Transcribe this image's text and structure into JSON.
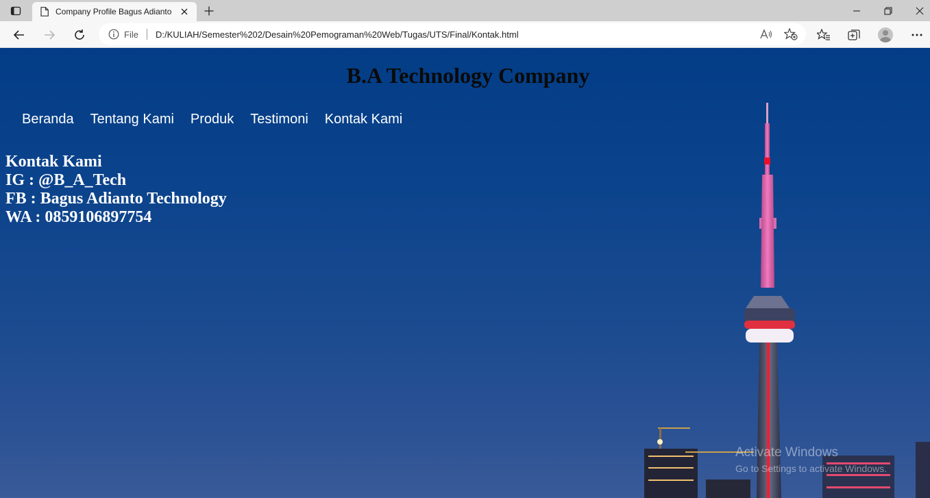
{
  "browser": {
    "tab_title": "Company Profile Bagus Adianto",
    "address_label": "File",
    "url": "D:/KULIAH/Semester%202/Desain%20Pemograman%20Web/Tugas/UTS/Final/Kontak.html"
  },
  "page": {
    "site_title": "B.A Technology Company",
    "nav": [
      "Beranda",
      "Tentang Kami",
      "Produk",
      "Testimoni",
      "Kontak Kami"
    ],
    "contact": {
      "heading": "Kontak Kami",
      "ig": "IG : @B_A_Tech",
      "fb": "FB : Bagus Adianto Technology",
      "wa": "WA : 0859106897754"
    }
  },
  "watermark": {
    "line1": "Activate Windows",
    "line2": "Go to Settings to activate Windows."
  },
  "colors": {
    "sky_top": "#033d86",
    "sky_bottom": "#3a5a98",
    "tower_pink": "#e85aa8",
    "tower_red": "#e8102a",
    "nav_text": "#ffffff"
  }
}
